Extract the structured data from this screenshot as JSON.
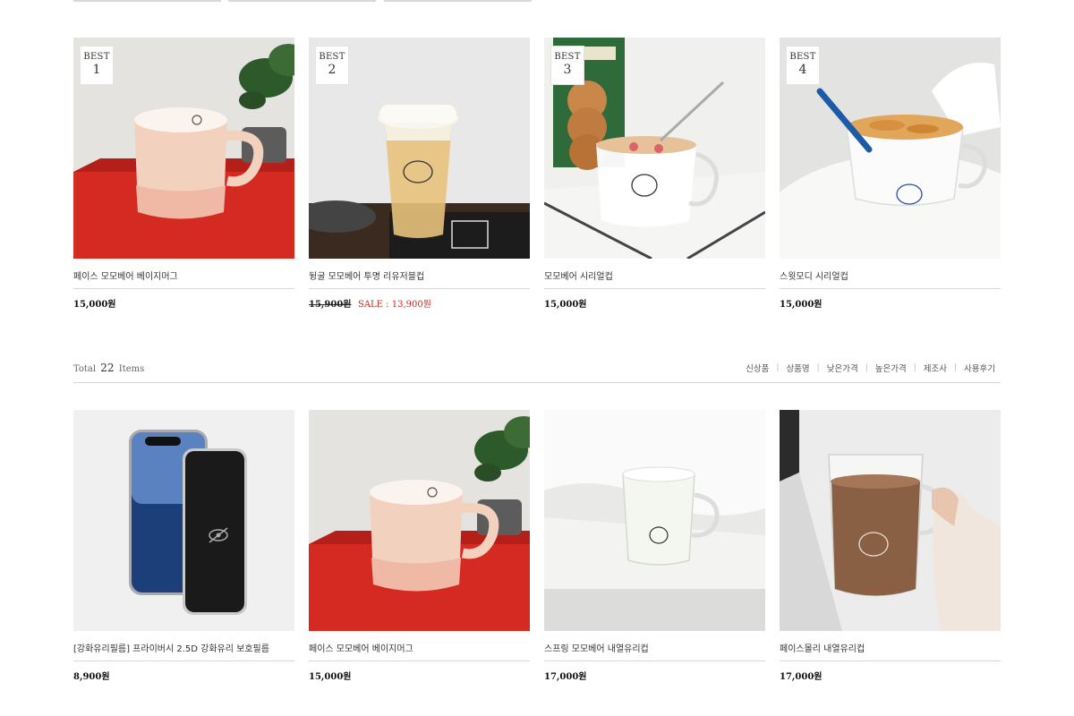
{
  "best": [
    {
      "badge_top": "BEST",
      "badge_rank": "1",
      "name": "페이스 모모베어 베이지머그",
      "price": "15,000원",
      "image": "beige-mug-red-box"
    },
    {
      "badge_top": "BEST",
      "badge_rank": "2",
      "name": "뒹굴 모모베어 투명 리유저블컵",
      "price_original": "15,900원",
      "price_sale": "SALE : 13,900원",
      "image": "reusable-cup-tea"
    },
    {
      "badge_top": "BEST",
      "badge_rank": "3",
      "name": "모모베어 시리얼컵",
      "price": "15,000원",
      "image": "cereal-cup-cookies"
    },
    {
      "badge_top": "BEST",
      "badge_rank": "4",
      "name": "스윗모디 시리얼컵",
      "price": "15,000원",
      "image": "cereal-cup-spoon"
    }
  ],
  "toolbar": {
    "total_prefix": "Total",
    "total_count": "22",
    "total_suffix": "Items",
    "sort_options": [
      "신상품",
      "상품명",
      "낮은가격",
      "높은가격",
      "제조사",
      "사용후기"
    ],
    "separator": "|"
  },
  "products": [
    {
      "name": "[강화유리필름] 프라이버시 2.5D 강화유리 보호필름",
      "price": "8,900원",
      "image": "phone-privacy-film"
    },
    {
      "name": "페이스 모모베어 베이지머그",
      "price": "15,000원",
      "image": "beige-mug-red-box"
    },
    {
      "name": "스프링 모모베어 내열유리컵",
      "price": "17,000원",
      "image": "glass-cup-water"
    },
    {
      "name": "페이스몰리 내열유리컵",
      "price": "17,000원",
      "image": "glass-cup-coffee"
    }
  ]
}
